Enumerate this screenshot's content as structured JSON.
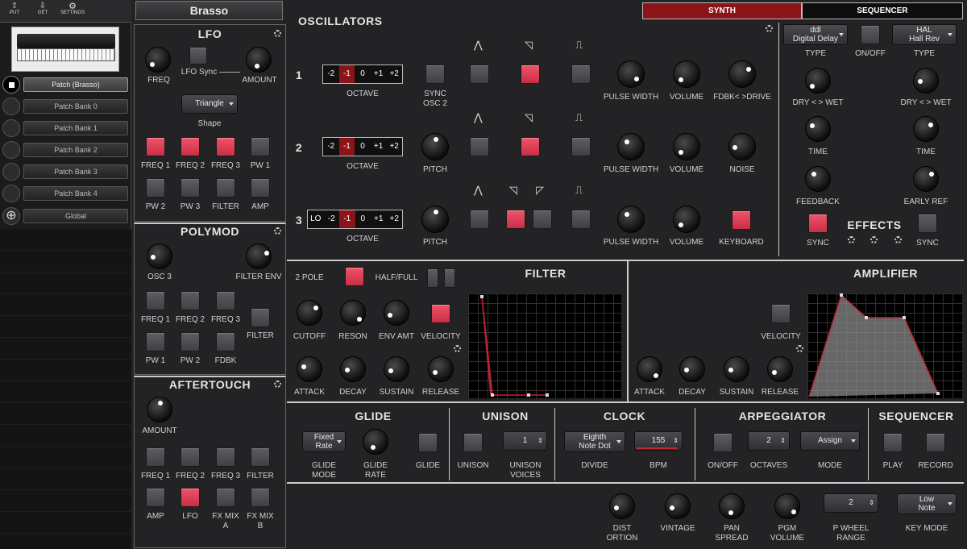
{
  "toolbar": {
    "put": "PUT",
    "get": "GET",
    "settings": "SETTINGS"
  },
  "sidebar": {
    "items": [
      {
        "label": "Patch (Brasso)",
        "active": true
      },
      {
        "label": "Patch Bank 0"
      },
      {
        "label": "Patch Bank 1"
      },
      {
        "label": "Patch Bank 2"
      },
      {
        "label": "Patch Bank 3"
      },
      {
        "label": "Patch Bank 4"
      },
      {
        "label": "Global"
      }
    ]
  },
  "patch_name": "Brasso",
  "tabs": {
    "synth": "SYNTH",
    "sequencer": "SEQUENCER",
    "active": "SYNTH"
  },
  "lfo": {
    "title": "LFO",
    "freq": "FREQ",
    "sync": "LFO Sync",
    "amount": "AMOUNT",
    "shape_value": "Triangle",
    "shape_label": "Shape",
    "buttons": [
      "FREQ 1",
      "FREQ 2",
      "FREQ 3",
      "PW 1",
      "PW 2",
      "PW 3",
      "FILTER",
      "AMP"
    ],
    "on": [
      true,
      true,
      true,
      false,
      false,
      false,
      false,
      false
    ]
  },
  "polymod": {
    "title": "POLYMOD",
    "osc3": "OSC 3",
    "filter_env": "FILTER ENV",
    "buttons": [
      "FREQ 1",
      "FREQ 2",
      "FREQ 3",
      "PW 1",
      "PW 2",
      "FDBK"
    ],
    "filter": "FILTER"
  },
  "aftertouch": {
    "title": "AFTERTOUCH",
    "amount": "AMOUNT",
    "buttons": [
      "FREQ 1",
      "FREQ 2",
      "FREQ 3",
      "FILTER",
      "AMP",
      "LFO",
      "FX MIX A",
      "FX MIX B"
    ],
    "on": [
      false,
      false,
      false,
      false,
      false,
      true,
      false,
      false
    ]
  },
  "oscillators": {
    "title": "OSCILLATORS",
    "octave_label": "OCTAVE",
    "sync_osc2": "SYNC OSC 2",
    "pitch": "PITCH",
    "pulse_width": "PULSE WIDTH",
    "volume": "VOLUME",
    "fdbk_drive": "FDBK< >DRIVE",
    "noise": "NOISE",
    "keyboard": "KEYBOARD",
    "rows": [
      {
        "num": "1",
        "octaves": [
          "-2",
          "-1",
          "0",
          "+1",
          "+2"
        ],
        "selected": "-1"
      },
      {
        "num": "2",
        "octaves": [
          "-2",
          "-1",
          "0",
          "+1",
          "+2"
        ],
        "selected": "-1"
      },
      {
        "num": "3",
        "octaves": [
          "LO",
          "-2",
          "-1",
          "0",
          "+1",
          "+2"
        ],
        "selected": "-1"
      }
    ],
    "wave_glyphs": {
      "tri": "⋀",
      "saw": "◹",
      "saw_rev": "◸",
      "pulse": "⎍"
    }
  },
  "effects": {
    "title": "EFFECTS",
    "a_top": "ddl",
    "a_type": "Digital Delay",
    "b_top": "HAL",
    "b_type": "Hall Rev",
    "type": "TYPE",
    "onoff": "ON/OFF",
    "drywet": "DRY < > WET",
    "time": "TIME",
    "feedback": "FEEDBACK",
    "early_ref": "EARLY REF",
    "sync": "SYNC"
  },
  "filter": {
    "title": "FILTER",
    "two_pole": "2 POLE",
    "half_full": "HALF/FULL",
    "cutoff": "CUTOFF",
    "reson": "RESON",
    "env_amt": "ENV AMT",
    "velocity": "VELOCITY",
    "attack": "ATTACK",
    "decay": "DECAY",
    "sustain": "SUSTAIN",
    "release": "RELEASE"
  },
  "amplifier": {
    "title": "AMPLIFIER",
    "velocity": "VELOCITY",
    "attack": "ATTACK",
    "decay": "DECAY",
    "sustain": "SUSTAIN",
    "release": "RELEASE"
  },
  "glide": {
    "title": "GLIDE",
    "mode_top": "Fixed",
    "mode_bot": "Rate",
    "glide_mode": "GLIDE MODE",
    "glide_rate": "GLIDE RATE",
    "glide": "GLIDE"
  },
  "unison": {
    "title": "UNISON",
    "unison": "UNISON",
    "voices_value": "1",
    "voices": "UNISON VOICES"
  },
  "clock": {
    "title": "CLOCK",
    "div_top": "Eighth",
    "div_bot": "Note Dot",
    "divide": "DIVIDE",
    "bpm_value": "155",
    "bpm": "BPM"
  },
  "arp": {
    "title": "ARPEGGIATOR",
    "onoff": "ON/OFF",
    "octaves_value": "2",
    "octaves": "OCTAVES",
    "mode_value": "Assign",
    "mode": "MODE"
  },
  "sequencer": {
    "title": "SEQUENCER",
    "play": "PLAY",
    "record": "RECORD"
  },
  "bottom": {
    "dist": "DIST ORTION",
    "vintage": "VINTAGE",
    "pan": "PAN SPREAD",
    "pgm": "PGM VOLUME",
    "pwheel_value": "2",
    "pwheel": "P WHEEL RANGE",
    "key_top": "Low",
    "key_bot": "Note",
    "keymode": "KEY MODE"
  },
  "colors": {
    "accent_red": "#e8485c",
    "tab_active": "#8b1418",
    "panel": "#232325"
  }
}
